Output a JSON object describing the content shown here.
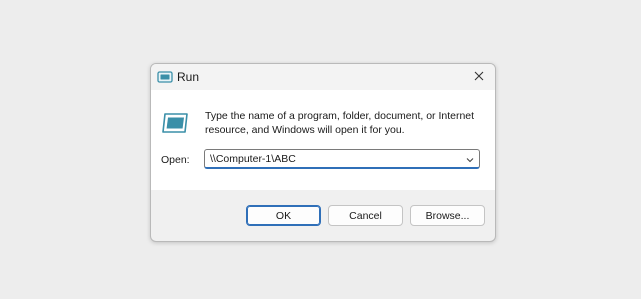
{
  "window": {
    "title": "Run",
    "close_glyph": "✕",
    "app_icon": "run-app-icon"
  },
  "content": {
    "icon": "run-program-icon",
    "description": "Type the name of a program, folder, document, or Internet resource, and Windows will open it for you.",
    "open_label": "Open:",
    "open_value": "\\\\Computer-1\\ABC"
  },
  "buttons": {
    "ok": "OK",
    "cancel": "Cancel",
    "browse": "Browse..."
  },
  "colors": {
    "accent": "#2f6fb8",
    "icon_teal": "#3a8fa8"
  }
}
